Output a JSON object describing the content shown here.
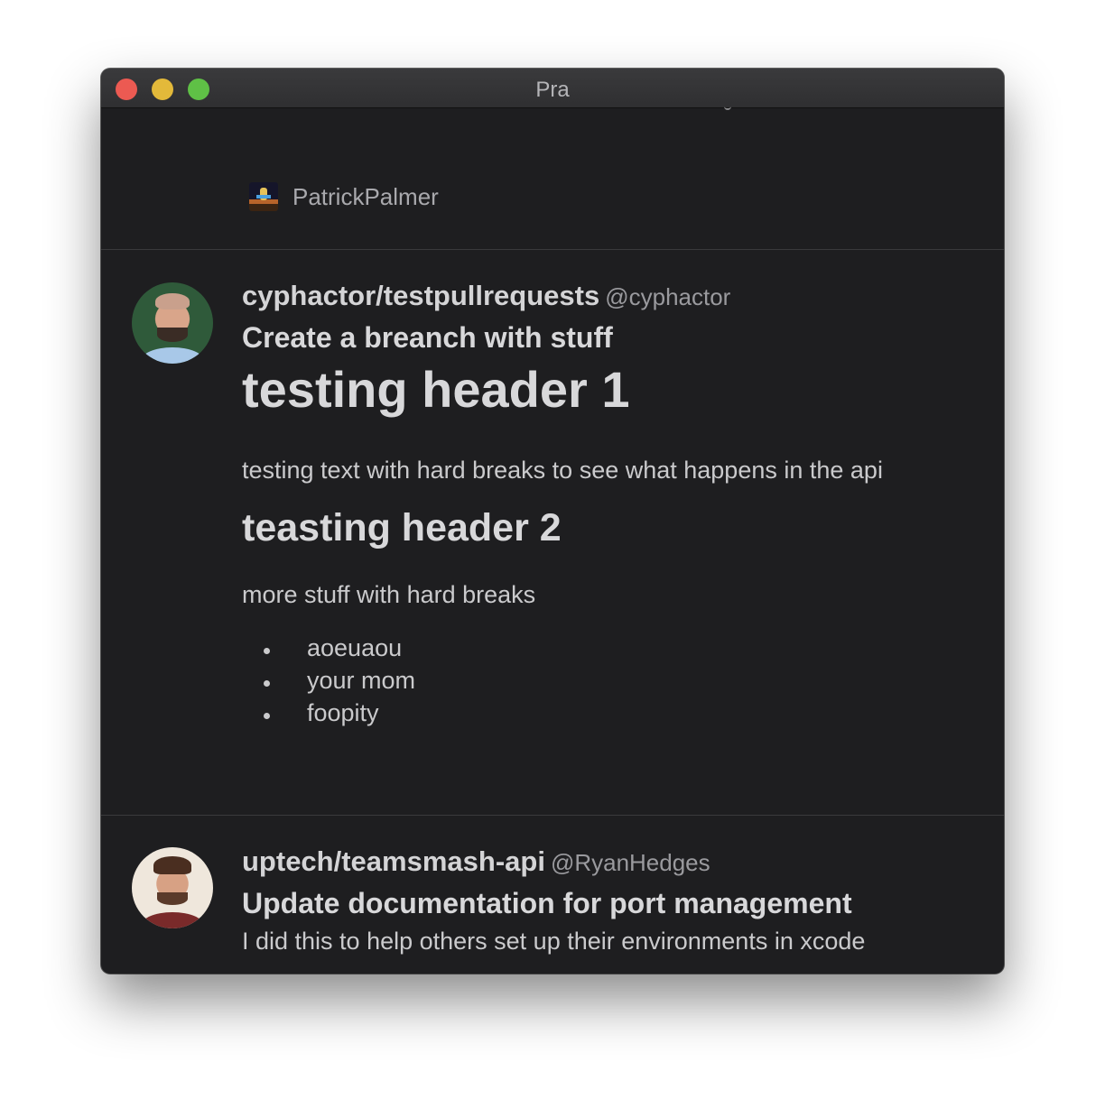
{
  "window": {
    "title": "Pra"
  },
  "user": {
    "name": "PatrickPalmer"
  },
  "feed": [
    {
      "repo": "cyphactor/testpullrequests",
      "handle": "@cyphactor",
      "title": "Create a breanch with stuff",
      "header1": "testing header 1",
      "paragraph1": "testing text with hard breaks to see what happens in the api",
      "header2": "teasting header 2",
      "paragraph2": "more stuff with hard breaks",
      "bullets": [
        "aoeuaou",
        "your mom",
        "foopity"
      ]
    },
    {
      "repo": "uptech/teamsmash-api",
      "handle": "@RyanHedges",
      "title": "Update documentation for port management",
      "body": "I did this to help others set up their environments in xcode"
    }
  ]
}
